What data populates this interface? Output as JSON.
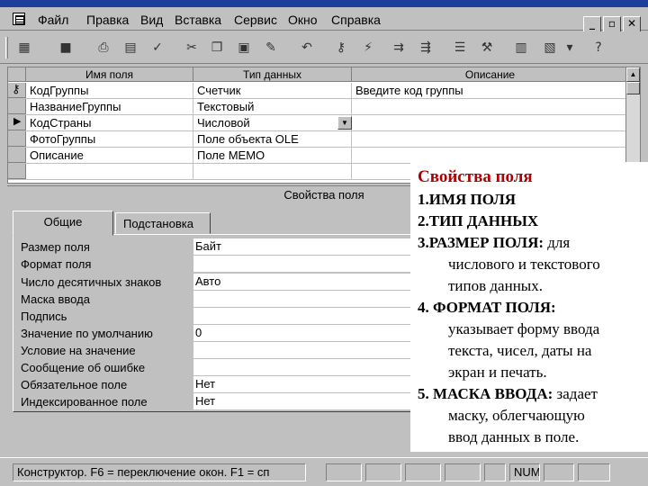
{
  "menubar": {
    "items": [
      "Файл",
      "Правка",
      "Вид",
      "Вставка",
      "Сервис",
      "Окно",
      "Справка"
    ],
    "window_buttons": [
      "_",
      "▫",
      "✕"
    ]
  },
  "toolbar": {
    "icons": [
      "table-view-icon",
      "save-icon",
      "print-icon",
      "print-preview-icon",
      "spellcheck-icon",
      "cut-icon",
      "copy-icon",
      "paste-icon",
      "format-painter-icon",
      "undo-icon",
      "primary-key-icon",
      "indexes-icon",
      "insert-row-icon",
      "delete-row-icon",
      "properties-icon",
      "build-icon",
      "database-window-icon",
      "new-object-icon",
      "help-icon"
    ]
  },
  "grid": {
    "headers": [
      "Имя поля",
      "Тип данных",
      "Описание"
    ],
    "rows": [
      {
        "name": "КодГруппы",
        "type": "Счетчик",
        "desc": "Введите код группы"
      },
      {
        "name": "НазваниеГруппы",
        "type": "Текстовый",
        "desc": ""
      },
      {
        "name": "КодСтраны",
        "type": "Числовой",
        "desc": ""
      },
      {
        "name": "ФотоГруппы",
        "type": "Поле объекта OLE",
        "desc": ""
      },
      {
        "name": "Описание",
        "type": "Поле MEMO",
        "desc": ""
      },
      {
        "name": "",
        "type": "",
        "desc": ""
      }
    ]
  },
  "props": {
    "title": "Свойства поля",
    "tabs": [
      "Общие",
      "Подстановка"
    ],
    "rows": [
      {
        "label": "Размер поля",
        "value": "Байт"
      },
      {
        "label": "Формат поля",
        "value": ""
      },
      {
        "label": "Число десятичных знаков",
        "value": "Авто"
      },
      {
        "label": "Маска ввода",
        "value": ""
      },
      {
        "label": "Подпись",
        "value": ""
      },
      {
        "label": "Значение по умолчанию",
        "value": "0"
      },
      {
        "label": "Условие на значение",
        "value": ""
      },
      {
        "label": "Сообщение об ошибке",
        "value": ""
      },
      {
        "label": "Обязательное поле",
        "value": "Нет"
      },
      {
        "label": "Индексированное поле",
        "value": "Нет"
      }
    ]
  },
  "statusbar": {
    "text": "Конструктор.  F6 = переключение окон.  F1 = сп",
    "num": "NUM"
  },
  "overlay": {
    "title": "Свойства поля",
    "l1": "1.ИМЯ ПОЛЯ",
    "l2": "2.ТИП ДАННЫХ",
    "l3_bold": "3.РАЗМЕР ПОЛЯ:",
    "l3_rest": " для",
    "l3_cont1": "числового и текстового",
    "l3_cont2": "типов данных.",
    "l4_bold": "4. ФОРМАТ ПОЛЯ:",
    "l4_cont1": "указывает форму ввода",
    "l4_cont2": "текста, чисел, даты на",
    "l4_cont3": "экран и печать.",
    "l5_bold": "5. МАСКА ВВОДА:",
    "l5_rest": " задает",
    "l5_cont1": "маску, облегчающую",
    "l5_cont2": "ввод данных в поле."
  }
}
